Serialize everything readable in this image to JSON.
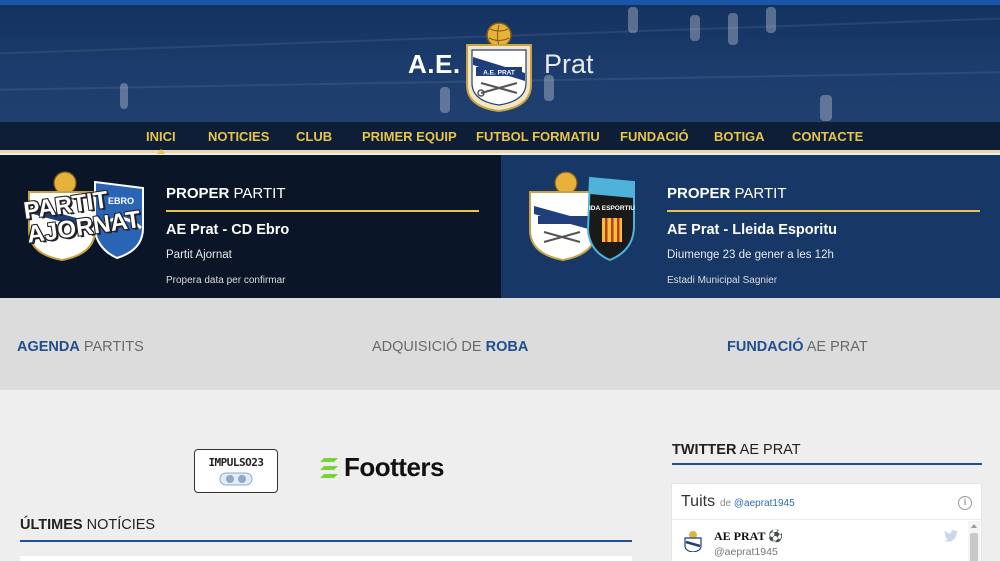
{
  "brand": {
    "left": "A.E.",
    "right": "Prat",
    "crest_text": "A.E. PRAT"
  },
  "nav": {
    "items": [
      {
        "label": "INICI",
        "active": true
      },
      {
        "label": "NOTICIES"
      },
      {
        "label": "CLUB"
      },
      {
        "label": "PRIMER EQUIP"
      },
      {
        "label": "FUTBOL FORMATIU"
      },
      {
        "label": "FUNDACIÓ"
      },
      {
        "label": "BOTIGA"
      },
      {
        "label": "CONTACTE"
      }
    ]
  },
  "matches": [
    {
      "head_bold": "PROPER",
      "head_rest": " PARTIT",
      "title": "AE Prat - CD Ebro",
      "subtitle": "Partit Ajornat",
      "note": "Propera data per confirmar",
      "overlay": [
        "PARTIT",
        "AJORNAT"
      ],
      "away_badge_text": "EBRO"
    },
    {
      "head_bold": "PROPER",
      "head_rest": " PARTIT",
      "title": "AE Prat - Lleida Esporitu",
      "subtitle": "Diumenge 23 de gener a les 12h",
      "note": "Estadi Municipal Sagnier",
      "away_badge_text": "IDA ESPORTIU"
    }
  ],
  "quicklinks": [
    {
      "bold": "AGENDA",
      "rest": " PARTITS",
      "bold_first": true
    },
    {
      "pre": "ADQUISICIÓ DE ",
      "bold": "ROBA",
      "bold_first": false
    },
    {
      "bold": "FUNDACIÓ",
      "rest": " AE PRAT",
      "bold_first": true
    }
  ],
  "sponsors": {
    "impulso": "IMPULSO23",
    "footters": "Footters"
  },
  "news": {
    "bold": "ÚLTIMES",
    "rest": " NOTÍCIES"
  },
  "twitter": {
    "head_bold": "TWITTER",
    "head_rest": " AE PRAT",
    "widget_title": "Tuits",
    "by_prefix": "de",
    "by_handle": "@aeprat1945",
    "tweet_name": "AE PRAT",
    "tweet_handle": "@aeprat1945"
  },
  "colors": {
    "gold": "#e7c44a",
    "navy": "#0d1e36",
    "blue_link": "#1f4f8f"
  }
}
